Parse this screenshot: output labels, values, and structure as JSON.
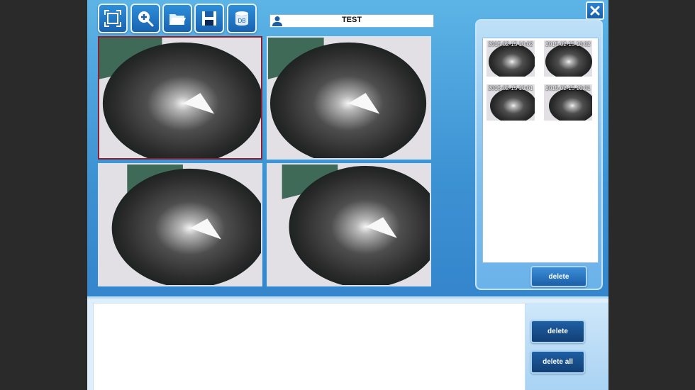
{
  "toolbar": {
    "buttons": [
      {
        "icon": "fullscreen-icon"
      },
      {
        "icon": "zoom-in-icon"
      },
      {
        "icon": "folder-open-icon"
      },
      {
        "icon": "save-icon"
      },
      {
        "icon": "database-icon",
        "label": "DB"
      }
    ]
  },
  "user": {
    "icon": "user-icon",
    "name": "TEST"
  },
  "window": {
    "close_icon": "close-icon"
  },
  "viewports": [
    {
      "name": "viewport-1",
      "selected": true
    },
    {
      "name": "viewport-2",
      "selected": false
    },
    {
      "name": "viewport-3",
      "selected": false
    },
    {
      "name": "viewport-4",
      "selected": false
    }
  ],
  "thumbnails": {
    "items": [
      {
        "label": "2015-02-15 10:02"
      },
      {
        "label": "2015-02-15 10:02"
      },
      {
        "label": "2015-02-15 10:01"
      },
      {
        "label": "2015-02-15 10:01"
      }
    ],
    "delete_label": "delete"
  },
  "bottom": {
    "notes_value": "",
    "delete_label": "delete",
    "delete_all_label": "delete all"
  },
  "colors": {
    "accent": "#2e7cc7",
    "selected_border": "#8a2030"
  }
}
